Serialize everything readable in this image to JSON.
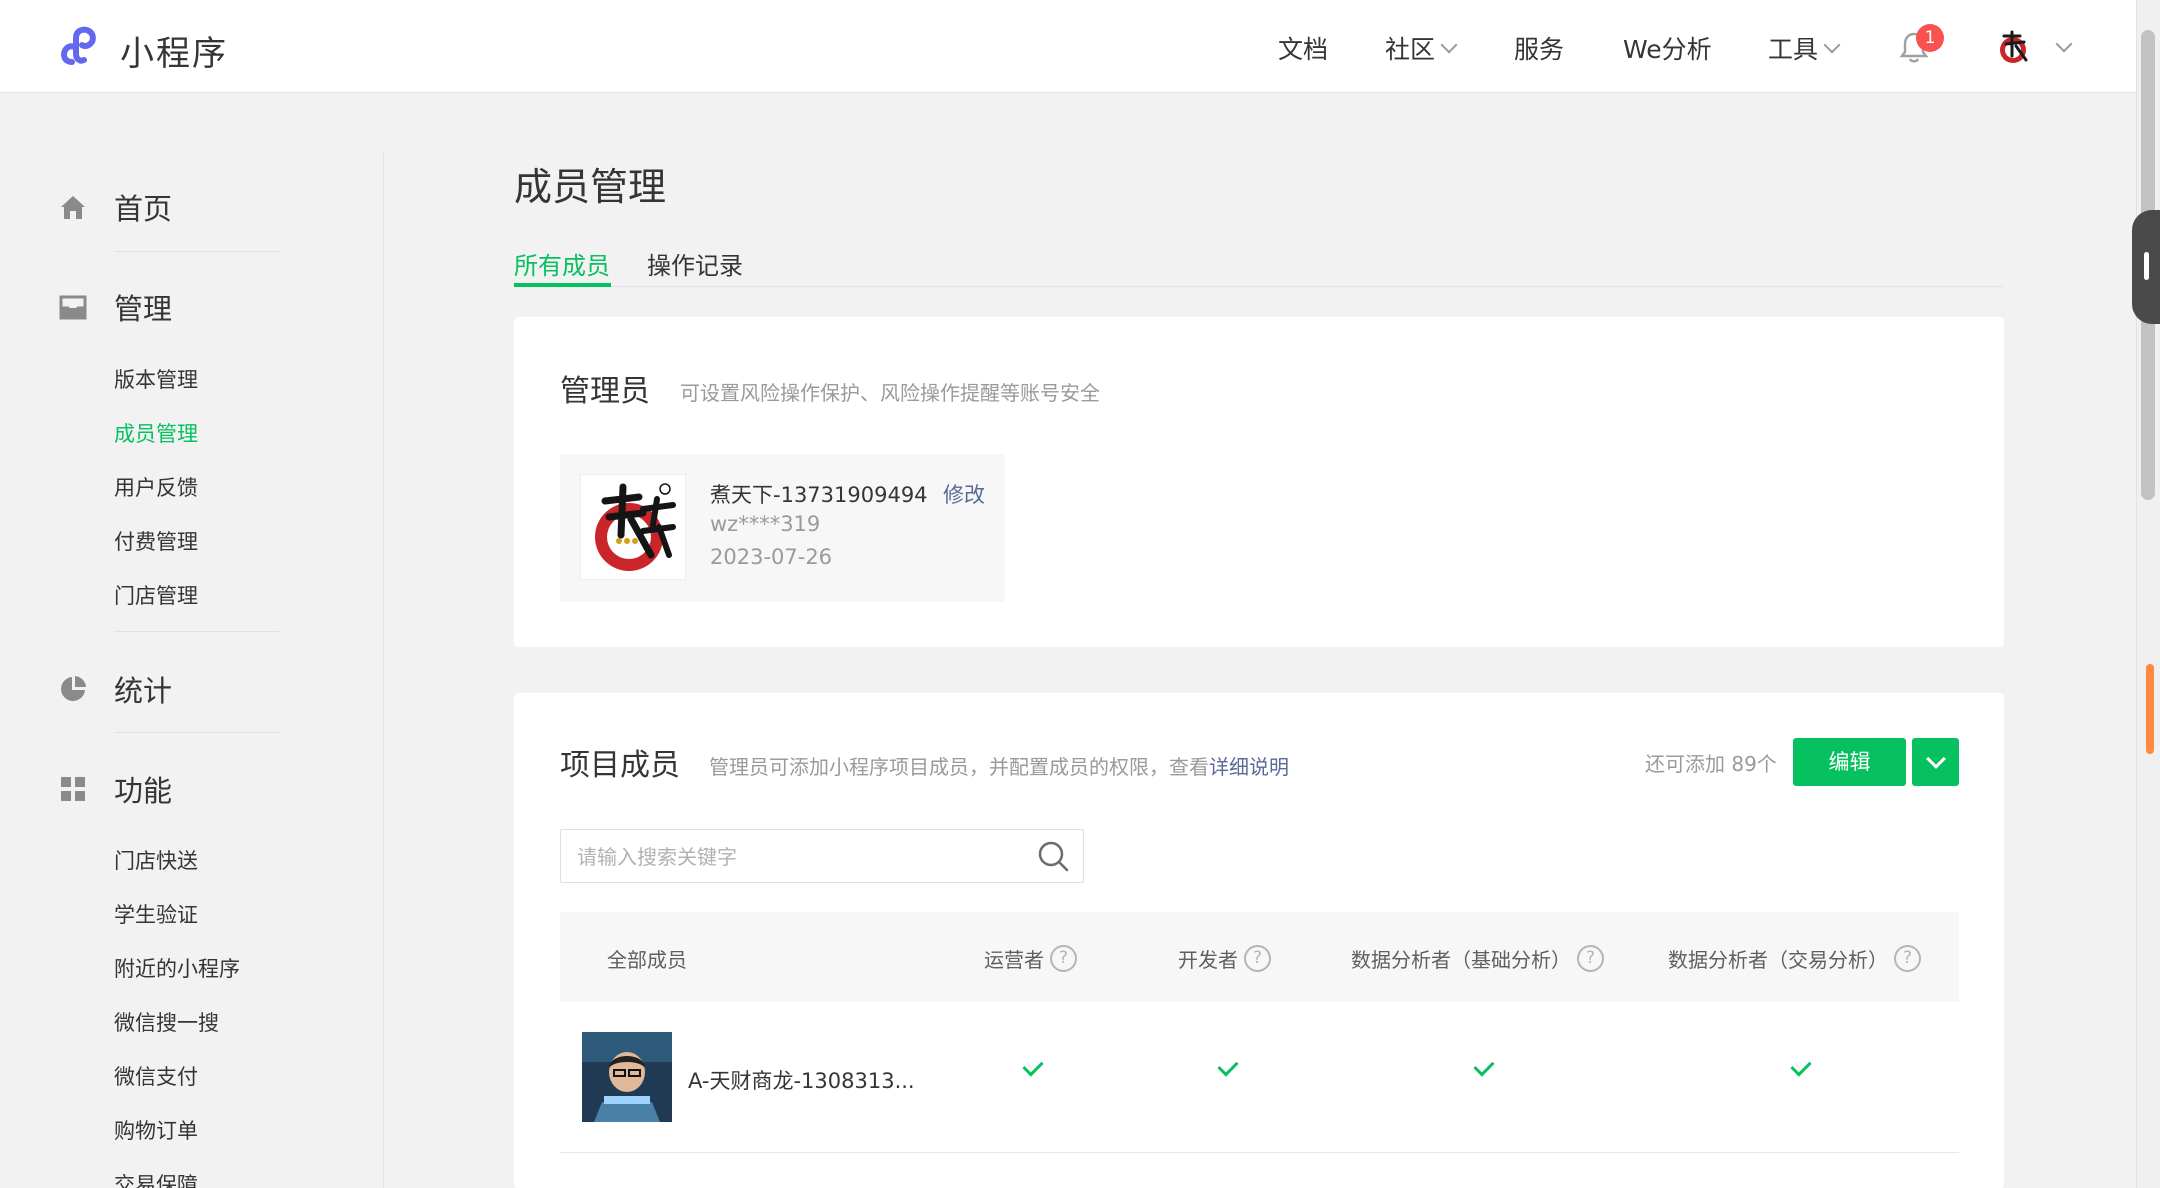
{
  "header": {
    "brand": "小程序",
    "nav": [
      {
        "label": "文档",
        "dropdown": false
      },
      {
        "label": "社区",
        "dropdown": true
      },
      {
        "label": "服务",
        "dropdown": false
      },
      {
        "label": "We分析",
        "dropdown": false
      },
      {
        "label": "工具",
        "dropdown": true
      }
    ],
    "notification_count": "1"
  },
  "sidebar": {
    "sections": [
      {
        "label": "首页",
        "icon": "home-icon"
      },
      {
        "label": "管理",
        "icon": "inbox-icon",
        "items": [
          "版本管理",
          "成员管理",
          "用户反馈",
          "付费管理",
          "门店管理"
        ],
        "active": "成员管理"
      },
      {
        "label": "统计",
        "icon": "pie-chart-icon"
      },
      {
        "label": "功能",
        "icon": "grid-icon",
        "items": [
          "门店快送",
          "学生验证",
          "附近的小程序",
          "微信搜一搜",
          "微信支付",
          "购物订单",
          "交易保障"
        ]
      }
    ]
  },
  "main": {
    "title": "成员管理",
    "tabs": [
      {
        "label": "所有成员",
        "active": true
      },
      {
        "label": "操作记录",
        "active": false
      }
    ],
    "admin": {
      "title": "管理员",
      "desc": "可设置风险操作保护、风险操作提醒等账号安全",
      "name": "煮天下-13731909494",
      "edit": "修改",
      "wxid": "wz****319",
      "date": "2023-07-26"
    },
    "members": {
      "title": "项目成员",
      "desc": "管理员可添加小程序项目成员，并配置成员的权限，查看",
      "desc_link": "详细说明",
      "remain": "还可添加 89个",
      "edit_button": "编辑",
      "search_placeholder": "请输入搜索关键字",
      "columns": [
        "全部成员",
        "运营者",
        "开发者",
        "数据分析者（基础分析）",
        "数据分析者（交易分析）"
      ],
      "help_mark": "?",
      "rows": [
        {
          "name": "A-天财商龙-1308313...",
          "roles": [
            true,
            true,
            true,
            true
          ]
        }
      ]
    }
  },
  "colors": {
    "accent": "#07c160",
    "link": "#576b95",
    "badge": "#fa5151"
  }
}
